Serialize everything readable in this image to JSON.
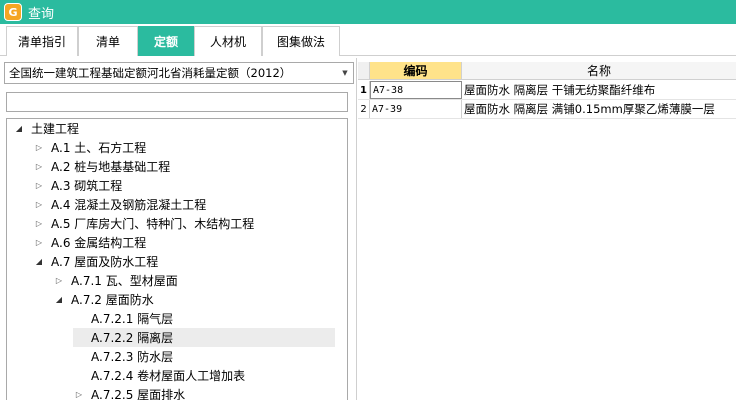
{
  "window": {
    "title": "查询",
    "icon": "app-logo-icon",
    "accent": "#2bbb9f"
  },
  "tabs": [
    {
      "label": "清单指引",
      "active": false
    },
    {
      "label": "清单",
      "active": false
    },
    {
      "label": "定额",
      "active": true
    },
    {
      "label": "人材机",
      "active": false
    },
    {
      "label": "图集做法",
      "active": false
    }
  ],
  "quota_library": {
    "selected": "全国统一建筑工程基础定额河北省消耗量定额（2012）"
  },
  "search": {
    "value": "",
    "placeholder": ""
  },
  "tree": [
    {
      "label": "土建工程",
      "expander": "◢"
    },
    {
      "label": "A.1 土、石方工程",
      "expander": "▷"
    },
    {
      "label": "A.2 桩与地基基础工程",
      "expander": "▷"
    },
    {
      "label": "A.3 砌筑工程",
      "expander": "▷"
    },
    {
      "label": "A.4 混凝土及钢筋混凝土工程",
      "expander": "▷"
    },
    {
      "label": "A.5 厂库房大门、特种门、木结构工程",
      "expander": "▷"
    },
    {
      "label": "A.6 金属结构工程",
      "expander": "▷"
    },
    {
      "label": "A.7 屋面及防水工程",
      "expander": "◢"
    },
    {
      "label": "A.7.1 瓦、型材屋面",
      "expander": "▷"
    },
    {
      "label": "A.7.2 屋面防水",
      "expander": "◢"
    },
    {
      "label": "A.7.2.1 隔气层",
      "expander": ""
    },
    {
      "label": "A.7.2.2 隔离层",
      "expander": "",
      "selected": true
    },
    {
      "label": "A.7.2.3 防水层",
      "expander": ""
    },
    {
      "label": "A.7.2.4 卷材屋面人工增加表",
      "expander": ""
    },
    {
      "label": "A.7.2.5 屋面排水",
      "expander": "▷"
    }
  ],
  "grid": {
    "columns": {
      "code": "编码",
      "name": "名称"
    },
    "rows": [
      {
        "num": "1",
        "code": "A7-38",
        "name": "屋面防水 隔离层 干铺无纺聚酯纤维布"
      },
      {
        "num": "2",
        "code": "A7-39",
        "name": "屋面防水 隔离层 满铺0.15mm厚聚乙烯薄膜一层"
      }
    ]
  }
}
